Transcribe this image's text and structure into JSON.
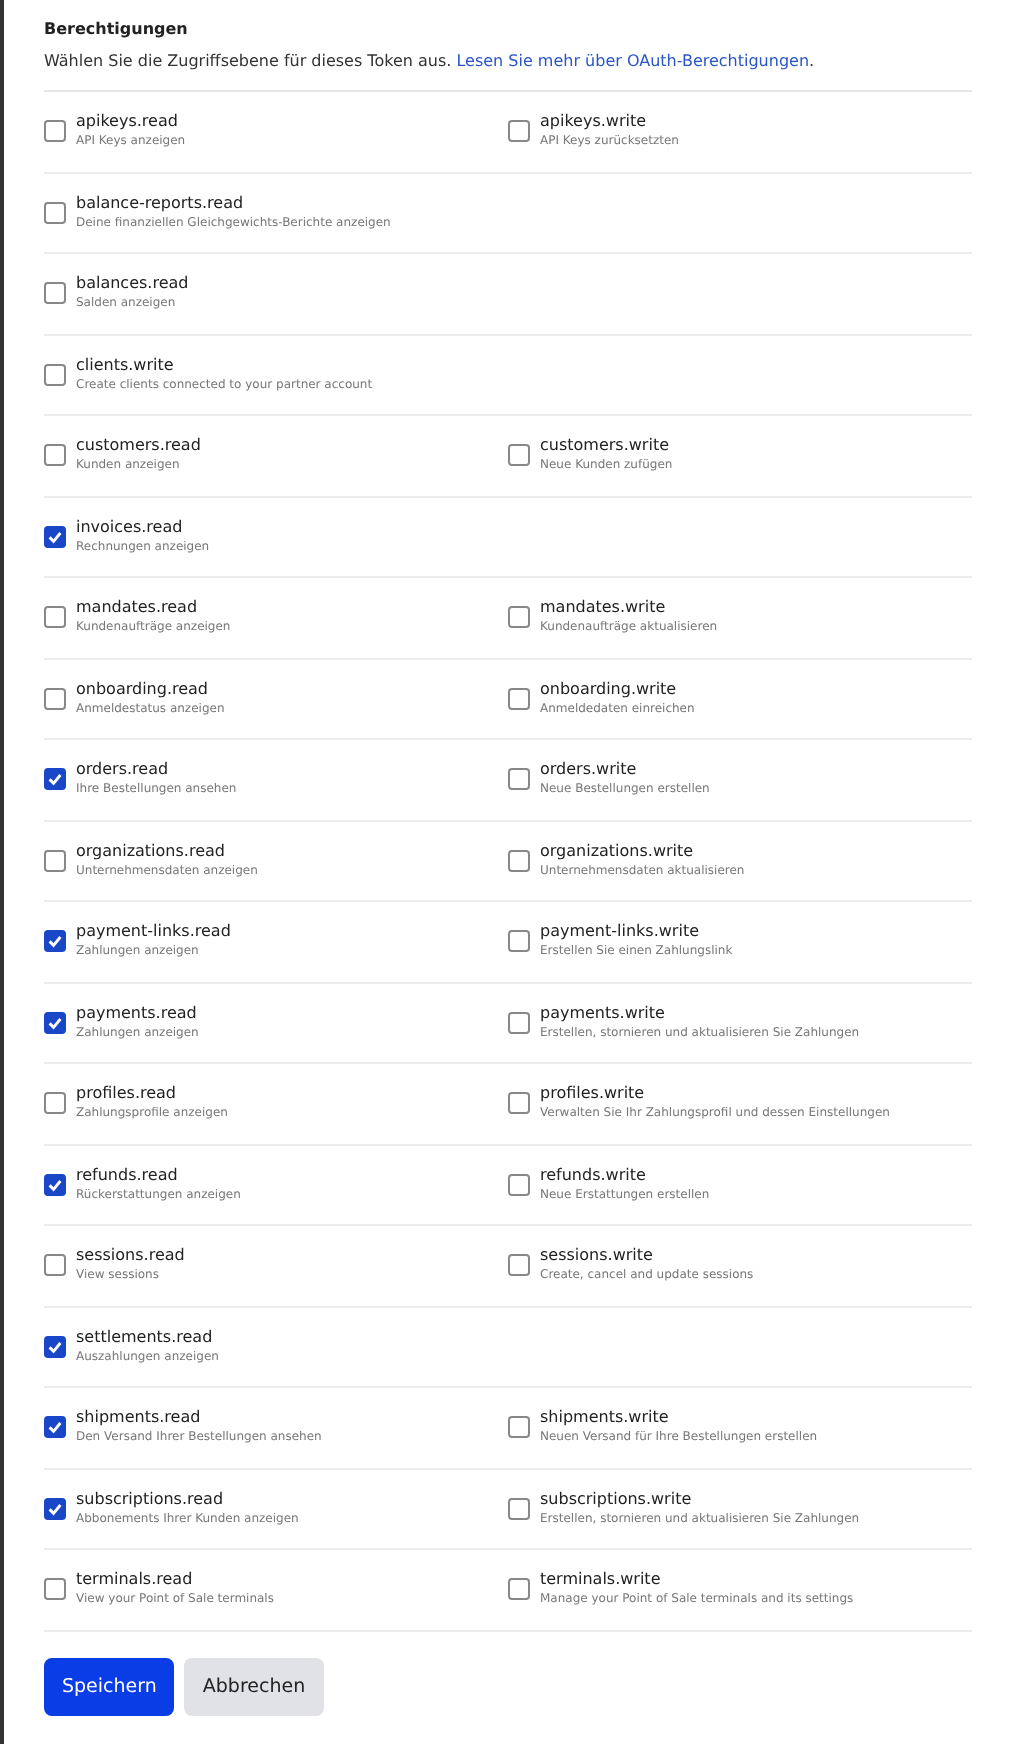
{
  "section": {
    "title": "Berechtigungen",
    "intro": "Wählen Sie die Zugriffsebene für dieses Token aus. ",
    "link": "Lesen Sie mehr über OAuth-Berechtigungen",
    "after_link": "."
  },
  "rows": [
    [
      {
        "name": "apikeys.read",
        "description": "API Keys anzeigen",
        "checked": false
      },
      {
        "name": "apikeys.write",
        "description": "API Keys zurücksetzten",
        "checked": false
      }
    ],
    [
      {
        "name": "balance-reports.read",
        "description": "Deine finanziellen Gleichgewichts-Berichte anzeigen",
        "checked": false
      }
    ],
    [
      {
        "name": "balances.read",
        "description": "Salden anzeigen",
        "checked": false
      }
    ],
    [
      {
        "name": "clients.write",
        "description": "Create clients connected to your partner account",
        "checked": false
      }
    ],
    [
      {
        "name": "customers.read",
        "description": "Kunden anzeigen",
        "checked": false
      },
      {
        "name": "customers.write",
        "description": "Neue Kunden zufügen",
        "checked": false
      }
    ],
    [
      {
        "name": "invoices.read",
        "description": "Rechnungen anzeigen",
        "checked": true
      }
    ],
    [
      {
        "name": "mandates.read",
        "description": "Kundenaufträge anzeigen",
        "checked": false
      },
      {
        "name": "mandates.write",
        "description": "Kundenaufträge aktualisieren",
        "checked": false
      }
    ],
    [
      {
        "name": "onboarding.read",
        "description": "Anmeldestatus anzeigen",
        "checked": false
      },
      {
        "name": "onboarding.write",
        "description": "Anmeldedaten einreichen",
        "checked": false
      }
    ],
    [
      {
        "name": "orders.read",
        "description": "Ihre Bestellungen ansehen",
        "checked": true
      },
      {
        "name": "orders.write",
        "description": "Neue Bestellungen erstellen",
        "checked": false
      }
    ],
    [
      {
        "name": "organizations.read",
        "description": "Unternehmensdaten anzeigen",
        "checked": false
      },
      {
        "name": "organizations.write",
        "description": "Unternehmensdaten aktualisieren",
        "checked": false
      }
    ],
    [
      {
        "name": "payment-links.read",
        "description": "Zahlungen anzeigen",
        "checked": true
      },
      {
        "name": "payment-links.write",
        "description": "Erstellen Sie einen Zahlungslink",
        "checked": false
      }
    ],
    [
      {
        "name": "payments.read",
        "description": "Zahlungen anzeigen",
        "checked": true
      },
      {
        "name": "payments.write",
        "description": "Erstellen, stornieren und aktualisieren Sie Zahlungen",
        "checked": false
      }
    ],
    [
      {
        "name": "profiles.read",
        "description": "Zahlungsprofile anzeigen",
        "checked": false
      },
      {
        "name": "profiles.write",
        "description": "Verwalten Sie Ihr Zahlungsprofil und dessen Einstellungen",
        "checked": false
      }
    ],
    [
      {
        "name": "refunds.read",
        "description": "Rückerstattungen anzeigen",
        "checked": true
      },
      {
        "name": "refunds.write",
        "description": "Neue Erstattungen erstellen",
        "checked": false
      }
    ],
    [
      {
        "name": "sessions.read",
        "description": "View sessions",
        "checked": false
      },
      {
        "name": "sessions.write",
        "description": "Create, cancel and update sessions",
        "checked": false
      }
    ],
    [
      {
        "name": "settlements.read",
        "description": "Auszahlungen anzeigen",
        "checked": true
      }
    ],
    [
      {
        "name": "shipments.read",
        "description": "Den Versand Ihrer Bestellungen ansehen",
        "checked": true
      },
      {
        "name": "shipments.write",
        "description": "Neuen Versand für Ihre Bestellungen erstellen",
        "checked": false
      }
    ],
    [
      {
        "name": "subscriptions.read",
        "description": "Abbonements Ihrer Kunden anzeigen",
        "checked": true
      },
      {
        "name": "subscriptions.write",
        "description": "Erstellen, stornieren und aktualisieren Sie Zahlungen",
        "checked": false
      }
    ],
    [
      {
        "name": "terminals.read",
        "description": "View your Point of Sale terminals",
        "checked": false
      },
      {
        "name": "terminals.write",
        "description": "Manage your Point of Sale terminals and its settings",
        "checked": false
      }
    ]
  ],
  "buttons": [
    {
      "label": "Speichern",
      "kind": "primary"
    },
    {
      "label": "Abbrechen",
      "kind": "secondary"
    }
  ]
}
